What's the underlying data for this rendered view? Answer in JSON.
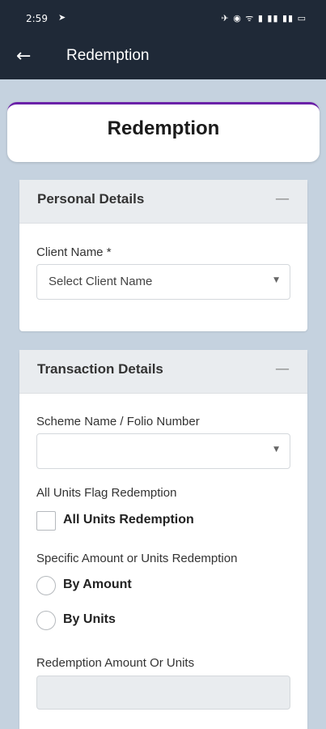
{
  "status_bar": {
    "time": "2:59",
    "telegram_icon": "telegram-icon",
    "right_icons": "✈ ◉ ᯤ ▮ ▮▮ ▮▮ ▭"
  },
  "app_bar": {
    "back_icon": "←",
    "title": "Redemption"
  },
  "page": {
    "heading": "Redemption"
  },
  "personal_details": {
    "header": "Personal Details",
    "collapse_icon": "—",
    "client_label": "Client Name *",
    "client_select": "Select Client Name",
    "caret": "▼"
  },
  "transaction_details": {
    "header": "Transaction Details",
    "collapse_icon": "—",
    "scheme_label": "Scheme Name / Folio Number",
    "scheme_select": "",
    "caret": "▼",
    "all_units_flag_label": "All Units Flag Redemption",
    "all_units_checkbox": "All Units Redemption",
    "specific_label": "Specific Amount or Units Redemption",
    "by_amount": "By Amount",
    "by_units": "By Units",
    "redemption_amount_label": "Redemption Amount Or Units",
    "redemption_amount_value": ""
  },
  "colors": {
    "app_bar": "#1f2937",
    "accent": "#6b21a8",
    "background": "#c5d2df"
  }
}
